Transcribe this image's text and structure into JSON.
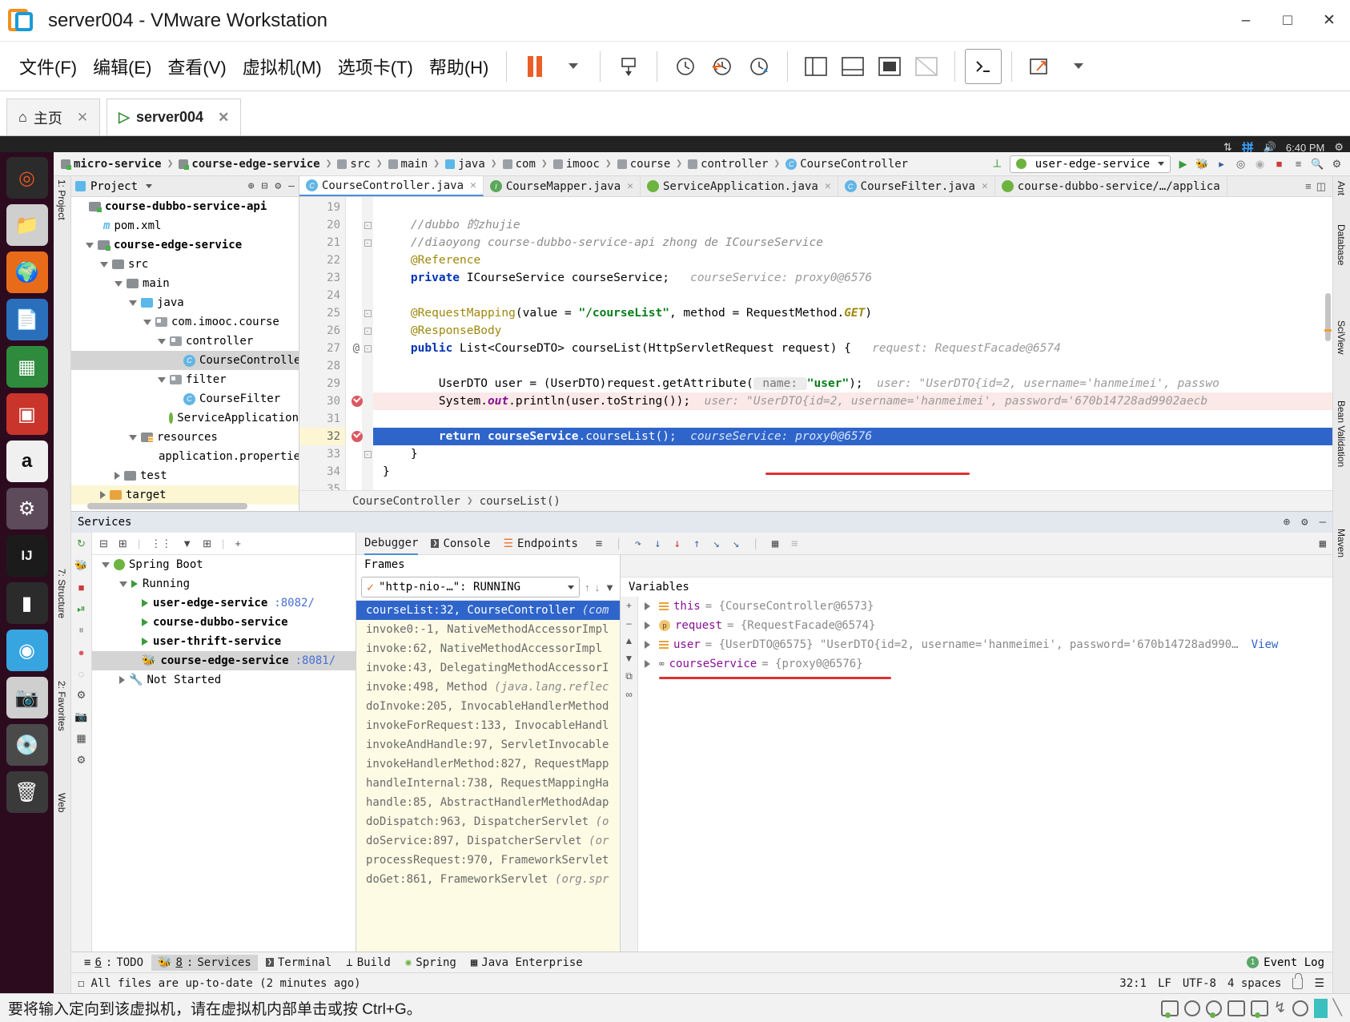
{
  "vmware": {
    "title": "server004 - VMware Workstation",
    "menus": [
      "文件(F)",
      "编辑(E)",
      "查看(V)",
      "虚拟机(M)",
      "选项卡(T)",
      "帮助(H)"
    ],
    "window_controls": [
      "minimize",
      "maximize",
      "close"
    ],
    "tabs": [
      {
        "label": "主页",
        "icon": "home-icon",
        "active": false
      },
      {
        "label": "server004",
        "icon": "vm-icon",
        "active": true
      }
    ],
    "status_message": "要将输入定向到该虚拟机，请在虚拟机内部单击或按 Ctrl+G。"
  },
  "guest_tray": {
    "ime": "拼",
    "time": "6:40 PM"
  },
  "ide": {
    "breadcrumb": [
      {
        "label": "micro-service",
        "icon": "module-icon",
        "bold": true
      },
      {
        "label": "course-edge-service",
        "icon": "module-icon",
        "bold": true
      },
      {
        "label": "src",
        "icon": "folder-icon",
        "bold": false
      },
      {
        "label": "main",
        "icon": "folder-icon",
        "bold": false
      },
      {
        "label": "java",
        "icon": "source-folder-icon",
        "bold": false
      },
      {
        "label": "com",
        "icon": "package-icon",
        "bold": false
      },
      {
        "label": "imooc",
        "icon": "package-icon",
        "bold": false
      },
      {
        "label": "course",
        "icon": "package-icon",
        "bold": false
      },
      {
        "label": "controller",
        "icon": "package-icon",
        "bold": false
      },
      {
        "label": "CourseController",
        "icon": "class-icon",
        "bold": false
      }
    ],
    "run_config": "user-edge-service",
    "project_panel": {
      "title": "Project",
      "tree": [
        {
          "label": "course-dubbo-service-api",
          "indent": 1,
          "icon": "module-icon",
          "bold": true,
          "clipped": true
        },
        {
          "label": "pom.xml",
          "indent": 2,
          "icon": "maven-icon",
          "bold": false
        },
        {
          "label": "course-edge-service",
          "indent": 1,
          "icon": "module-icon",
          "bold": true,
          "arrow": "down"
        },
        {
          "label": "src",
          "indent": 2,
          "icon": "folder-icon",
          "bold": false,
          "arrow": "down"
        },
        {
          "label": "main",
          "indent": 3,
          "icon": "folder-icon",
          "bold": false,
          "arrow": "down"
        },
        {
          "label": "java",
          "indent": 4,
          "icon": "source-folder-icon",
          "bold": false,
          "arrow": "down"
        },
        {
          "label": "com.imooc.course",
          "indent": 5,
          "icon": "package-icon",
          "bold": false,
          "arrow": "down"
        },
        {
          "label": "controller",
          "indent": 6,
          "icon": "package-icon",
          "bold": false,
          "arrow": "down"
        },
        {
          "label": "CourseController",
          "indent": 7,
          "icon": "class-icon",
          "bold": false,
          "selected": true
        },
        {
          "label": "filter",
          "indent": 6,
          "icon": "package-icon",
          "bold": false,
          "arrow": "down"
        },
        {
          "label": "CourseFilter",
          "indent": 7,
          "icon": "class-icon",
          "bold": false
        },
        {
          "label": "ServiceApplication",
          "indent": 6,
          "icon": "spring-class-icon",
          "bold": false
        },
        {
          "label": "resources",
          "indent": 4,
          "icon": "resources-folder-icon",
          "bold": false,
          "arrow": "down"
        },
        {
          "label": "application.properties",
          "indent": 5,
          "icon": "properties-icon",
          "bold": false
        },
        {
          "label": "test",
          "indent": 3,
          "icon": "folder-icon",
          "bold": false,
          "arrow": "right"
        },
        {
          "label": "target",
          "indent": 2,
          "icon": "target-folder-icon",
          "bold": false,
          "arrow": "right",
          "highlight": true
        }
      ]
    },
    "editor_tabs": [
      {
        "label": "CourseController.java",
        "icon": "class-icon",
        "active": true
      },
      {
        "label": "CourseMapper.java",
        "icon": "interface-icon",
        "active": false
      },
      {
        "label": "ServiceApplication.java",
        "icon": "spring-class-icon",
        "active": false
      },
      {
        "label": "CourseFilter.java",
        "icon": "class-icon",
        "active": false
      },
      {
        "label": "course-dubbo-service/…/applica",
        "icon": "spring-config-icon",
        "active": false
      }
    ],
    "code": {
      "first_line": 19,
      "lines": [
        {
          "n": 19,
          "html": ""
        },
        {
          "n": 20,
          "html": "<span class=\"cmt\">    //dubbo 的zhujie</span>",
          "fold": true
        },
        {
          "n": 21,
          "html": "<span class=\"cmt\">    //diaoyong course-dubbo-service-api zhong de ICourseService</span>",
          "fold": true
        },
        {
          "n": 22,
          "html": "<span class=\"ann\">    @Reference</span>"
        },
        {
          "n": 23,
          "html": "    <span class=\"kw\">private</span> ICourseService courseService;<span class=\"hint\">   courseService: proxy0@6576</span>"
        },
        {
          "n": 24,
          "html": ""
        },
        {
          "n": 25,
          "html": "<span class=\"ann\">    @RequestMapping</span>(value = <span class=\"str\">\"/courseList\"</span>, method = RequestMethod.<span class=\"kw\" style=\"color:#9e880d\"><i>GET</i></span>)",
          "fold": true
        },
        {
          "n": 26,
          "html": "<span class=\"ann\">    @ResponseBody</span>",
          "fold": true
        },
        {
          "n": 27,
          "html": "    <span class=\"kw\">public</span> List&lt;CourseDTO&gt; courseList(HttpServletRequest request) {<span class=\"hint\">   request: RequestFacade@6574</span>",
          "marker": "@",
          "fold": true
        },
        {
          "n": 28,
          "html": ""
        },
        {
          "n": 29,
          "html": "        UserDTO user = (UserDTO)request.getAttribute(<span class=\"hintchip\"> name: </span><span class=\"str\">\"user\"</span>);<span class=\"hint\">  user: \"UserDTO{id=2, username='hanmeimei', passwo</span>"
        },
        {
          "n": 30,
          "html": "        System.<span class=\"kw\" style=\"color:#871094\"><i>out</i></span>.println(user.toString());<span class=\"hint\">  user: \"UserDTO{id=2, username='hanmeimei', password='670b14728ad9902aecb</span>",
          "breakpoint": true,
          "bpline": true
        },
        {
          "n": 31,
          "html": ""
        },
        {
          "n": 32,
          "html": "        <span class=\"kw\" style=\"color:#fff;font-weight:bold\">return</span> <span style=\"font-weight:bold\">courseService</span>.courseList();<span class=\"hint\">  courseService: proxy0@6576</span>",
          "breakpoint": true,
          "exec": true
        },
        {
          "n": 33,
          "html": "    }",
          "fold": true
        },
        {
          "n": 34,
          "html": "}"
        }
      ],
      "footer_breadcrumb": [
        "CourseController",
        "courseList()"
      ]
    },
    "services_panel": {
      "title": "Services",
      "tree": [
        {
          "label": "Spring Boot",
          "indent": 1,
          "icon": "spring-icon",
          "arrow": "down"
        },
        {
          "label": "Running",
          "indent": 2,
          "icon": "run-icon",
          "arrow": "down"
        },
        {
          "label": "user-edge-service",
          "port": ":8082/",
          "indent": 3,
          "icon": "run-icon",
          "bold": true
        },
        {
          "label": "course-dubbo-service",
          "port": "",
          "indent": 3,
          "icon": "run-icon",
          "bold": true
        },
        {
          "label": "user-thrift-service",
          "port": "",
          "indent": 3,
          "icon": "run-icon",
          "bold": true
        },
        {
          "label": "course-edge-service",
          "port": ":8081/",
          "indent": 3,
          "icon": "debug-icon",
          "bold": true,
          "selected": true
        },
        {
          "label": "Not Started",
          "indent": 2,
          "icon": "wrench-icon",
          "arrow": "right"
        }
      ]
    },
    "debugger": {
      "tabs": [
        {
          "label": "Debugger",
          "icon": "debugger-icon",
          "active": true
        },
        {
          "label": "Console",
          "icon": "console-icon",
          "active": false
        },
        {
          "label": "Endpoints",
          "icon": "endpoints-icon",
          "active": false
        }
      ],
      "frames_title": "Frames",
      "thread": "\"http-nio-…\": RUNNING",
      "frames": [
        {
          "text": "courseList:32, CourseController ",
          "italic": "(com",
          "selected": true
        },
        {
          "text": "invoke0:-1, NativeMethodAccessorImpl",
          "italic": ""
        },
        {
          "text": "invoke:62, NativeMethodAccessorImpl",
          "italic": ""
        },
        {
          "text": "invoke:43, DelegatingMethodAccessorI",
          "italic": ""
        },
        {
          "text": "invoke:498, Method ",
          "italic": "(java.lang.reflec"
        },
        {
          "text": "doInvoke:205, InvocableHandlerMethod",
          "italic": ""
        },
        {
          "text": "invokeForRequest:133, InvocableHandl",
          "italic": ""
        },
        {
          "text": "invokeAndHandle:97, ServletInvocable",
          "italic": ""
        },
        {
          "text": "invokeHandlerMethod:827, RequestMapp",
          "italic": ""
        },
        {
          "text": "handleInternal:738, RequestMappingHa",
          "italic": ""
        },
        {
          "text": "handle:85, AbstractHandlerMethodAdap",
          "italic": ""
        },
        {
          "text": "doDispatch:963, DispatcherServlet ",
          "italic": "(o"
        },
        {
          "text": "doService:897, DispatcherServlet ",
          "italic": "(or"
        },
        {
          "text": "processRequest:970, FrameworkServlet",
          "italic": ""
        },
        {
          "text": "doGet:861, FrameworkServlet ",
          "italic": "(org.spr"
        }
      ],
      "variables_title": "Variables",
      "variables": [
        {
          "name": "this",
          "value": "= {CourseController@6573}",
          "badge": "field-icon",
          "extra": ""
        },
        {
          "name": "request",
          "value": "= {RequestFacade@6574}",
          "badge": "param-icon",
          "extra": ""
        },
        {
          "name": "user",
          "value": "= {UserDTO@6575} \"UserDTO{id=2, username='hanmeimei', password='670b14728ad990…",
          "badge": "field-icon",
          "extra": "View"
        },
        {
          "name": "courseService",
          "value": "= {proxy0@6576}",
          "badge": "oo-icon",
          "extra": ""
        }
      ]
    },
    "tool_window_bar": [
      {
        "num": "6",
        "label": "TODO",
        "icon": "todo-icon",
        "active": false
      },
      {
        "num": "8",
        "label": "Services",
        "icon": "services-icon",
        "active": true
      },
      {
        "num": "",
        "label": "Terminal",
        "icon": "terminal-icon",
        "active": false
      },
      {
        "num": "",
        "label": "Build",
        "icon": "build-icon",
        "active": false
      },
      {
        "num": "",
        "label": "Spring",
        "icon": "spring-icon",
        "active": false
      },
      {
        "num": "",
        "label": "Java Enterprise",
        "icon": "java-enterprise-icon",
        "active": false
      }
    ],
    "event_log": "Event Log",
    "event_log_count": "1",
    "status": {
      "message": "All files are up-to-date (2 minutes ago)",
      "caret": "32:1",
      "line_sep": "LF",
      "encoding": "UTF-8",
      "indent": "4 spaces"
    },
    "left_stripes": [
      "1: Project",
      "2: Favorites",
      "7: Structure",
      "Web"
    ],
    "right_stripes": [
      "Ant",
      "Database",
      "SciView",
      "Bean Validation",
      "Maven"
    ]
  },
  "launcher_icons": [
    "ubuntu-search-icon",
    "files-icon",
    "firefox-icon",
    "writer-icon",
    "calc-icon",
    "impress-icon",
    "amazon-icon",
    "settings-icon",
    "intellij-icon",
    "terminal-icon",
    "chrome-icon",
    "camera-icon",
    "dvd-icon",
    "trash-icon"
  ],
  "colors": {
    "accent": "#2f65ca",
    "orange": "#eb5e28",
    "exec_line": "#2f65ca",
    "breakpoint": "#db5860",
    "annotation_red": "#e03030"
  }
}
